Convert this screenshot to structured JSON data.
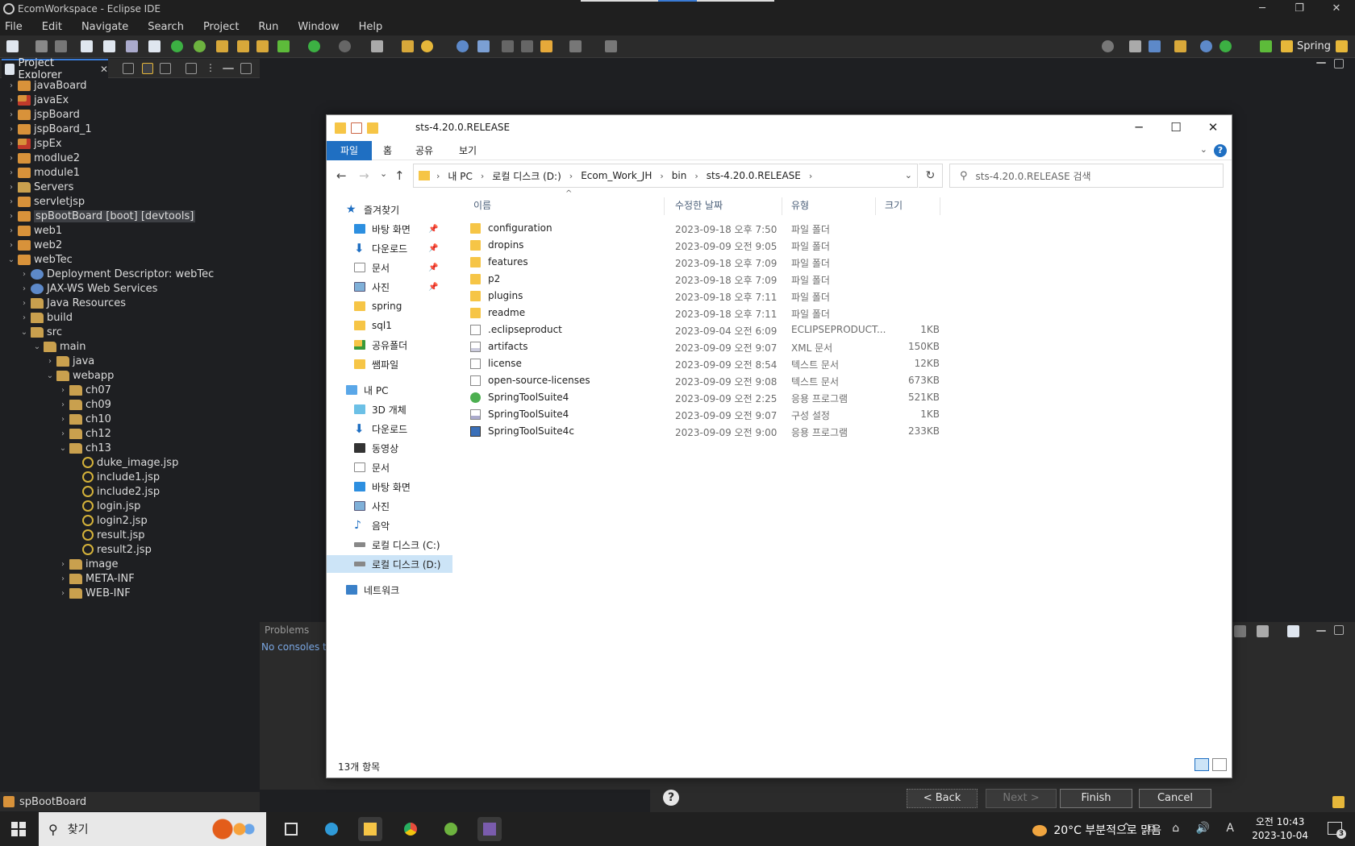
{
  "window": {
    "title": "EcomWorkspace - Eclipse IDE",
    "minimize": "─",
    "restore": "❐",
    "close": "✕"
  },
  "menu": [
    "File",
    "Edit",
    "Navigate",
    "Search",
    "Project",
    "Run",
    "Window",
    "Help"
  ],
  "toolbar": {
    "perspective_label": "Spring"
  },
  "project_explorer": {
    "tab_label": "Project Explorer",
    "tab_close": "✕",
    "items": [
      {
        "label": "javaBoard",
        "depth": 0,
        "expanded": false,
        "icon": "project-icon"
      },
      {
        "label": "javaEx",
        "depth": 0,
        "expanded": false,
        "icon": "project-error-icon"
      },
      {
        "label": "jspBoard",
        "depth": 0,
        "expanded": false,
        "icon": "project-icon"
      },
      {
        "label": "jspBoard_1",
        "depth": 0,
        "expanded": false,
        "icon": "project-icon"
      },
      {
        "label": "jspEx",
        "depth": 0,
        "expanded": false,
        "icon": "project-error-icon"
      },
      {
        "label": "modlue2",
        "depth": 0,
        "expanded": false,
        "icon": "project-icon"
      },
      {
        "label": "module1",
        "depth": 0,
        "expanded": false,
        "icon": "project-icon"
      },
      {
        "label": "Servers",
        "depth": 0,
        "expanded": false,
        "icon": "folder-icon"
      },
      {
        "label": "servletjsp",
        "depth": 0,
        "expanded": false,
        "icon": "project-icon"
      },
      {
        "label": "spBootBoard [boot] [devtools]",
        "depth": 0,
        "expanded": false,
        "icon": "project-icon",
        "selected": true
      },
      {
        "label": "web1",
        "depth": 0,
        "expanded": false,
        "icon": "project-icon"
      },
      {
        "label": "web2",
        "depth": 0,
        "expanded": false,
        "icon": "project-icon"
      },
      {
        "label": "webTec",
        "depth": 0,
        "expanded": true,
        "icon": "project-icon"
      },
      {
        "label": "Deployment Descriptor: webTec",
        "depth": 1,
        "expanded": false,
        "icon": "deployment-icon"
      },
      {
        "label": "JAX-WS Web Services",
        "depth": 1,
        "expanded": false,
        "icon": "deployment-icon"
      },
      {
        "label": "Java Resources",
        "depth": 1,
        "expanded": false,
        "icon": "folder-icon"
      },
      {
        "label": "build",
        "depth": 1,
        "expanded": false,
        "icon": "folder-icon"
      },
      {
        "label": "src",
        "depth": 1,
        "expanded": true,
        "icon": "folder-icon"
      },
      {
        "label": "main",
        "depth": 2,
        "expanded": true,
        "icon": "folder-icon"
      },
      {
        "label": "java",
        "depth": 3,
        "expanded": false,
        "icon": "folder-icon"
      },
      {
        "label": "webapp",
        "depth": 3,
        "expanded": true,
        "icon": "folder-icon"
      },
      {
        "label": "ch07",
        "depth": 4,
        "expanded": false,
        "icon": "folder-icon"
      },
      {
        "label": "ch09",
        "depth": 4,
        "expanded": false,
        "icon": "folder-icon"
      },
      {
        "label": "ch10",
        "depth": 4,
        "expanded": false,
        "icon": "folder-icon"
      },
      {
        "label": "ch12",
        "depth": 4,
        "expanded": false,
        "icon": "folder-icon"
      },
      {
        "label": "ch13",
        "depth": 4,
        "expanded": true,
        "icon": "folder-icon"
      },
      {
        "label": "duke_image.jsp",
        "depth": 5,
        "leaf": true,
        "icon": "jsp-file-icon"
      },
      {
        "label": "include1.jsp",
        "depth": 5,
        "leaf": true,
        "icon": "jsp-file-icon"
      },
      {
        "label": "include2.jsp",
        "depth": 5,
        "leaf": true,
        "icon": "jsp-file-icon"
      },
      {
        "label": "login.jsp",
        "depth": 5,
        "leaf": true,
        "icon": "jsp-file-icon"
      },
      {
        "label": "login2.jsp",
        "depth": 5,
        "leaf": true,
        "icon": "jsp-file-icon"
      },
      {
        "label": "result.jsp",
        "depth": 5,
        "leaf": true,
        "icon": "jsp-file-icon"
      },
      {
        "label": "result2.jsp",
        "depth": 5,
        "leaf": true,
        "icon": "jsp-file-icon"
      },
      {
        "label": "image",
        "depth": 4,
        "expanded": false,
        "icon": "folder-icon"
      },
      {
        "label": "META-INF",
        "depth": 4,
        "expanded": false,
        "icon": "folder-icon"
      },
      {
        "label": "WEB-INF",
        "depth": 4,
        "expanded": false,
        "icon": "folder-icon"
      }
    ],
    "bottom_label": "spBootBoard"
  },
  "console": {
    "problems_tab": "Problems",
    "message": "No consoles to"
  },
  "wizard_buttons": {
    "help": "?",
    "back": "< Back",
    "next": "Next >",
    "finish": "Finish",
    "cancel": "Cancel"
  },
  "file_explorer": {
    "title": "sts-4.20.0.RELEASE",
    "ribbon_tabs": {
      "file": "파일",
      "home": "홈",
      "share": "공유",
      "view": "보기"
    },
    "ribbon_help": "?",
    "nav": {
      "back": "←",
      "forward": "→",
      "history": "⌄",
      "up": "↑",
      "refresh": "↻",
      "dropdown": "⌄"
    },
    "breadcrumb": [
      "내 PC",
      "로컬 디스크 (D:)",
      "Ecom_Work_JH",
      "bin",
      "sts-4.20.0.RELEASE"
    ],
    "search_placeholder": "sts-4.20.0.RELEASE 검색",
    "nav_pane": [
      {
        "label": "즐겨찾기",
        "icon": "star-icon",
        "indent": 0
      },
      {
        "label": "바탕 화면",
        "icon": "desktop-icon",
        "indent": 1,
        "pinned": true
      },
      {
        "label": "다운로드",
        "icon": "download-icon",
        "indent": 1,
        "pinned": true
      },
      {
        "label": "문서",
        "icon": "document-icon",
        "indent": 1,
        "pinned": true
      },
      {
        "label": "사진",
        "icon": "picture-icon",
        "indent": 1,
        "pinned": true
      },
      {
        "label": "spring",
        "icon": "folder-icon",
        "indent": 1
      },
      {
        "label": "sql1",
        "icon": "folder-icon",
        "indent": 1
      },
      {
        "label": "공유폴더",
        "icon": "shared-folder-icon",
        "indent": 1
      },
      {
        "label": "쌤파일",
        "icon": "folder-icon",
        "indent": 1
      },
      {
        "label": "내 PC",
        "icon": "pc-icon",
        "indent": 0
      },
      {
        "label": "3D 개체",
        "icon": "cube-icon",
        "indent": 1
      },
      {
        "label": "다운로드",
        "icon": "download-icon",
        "indent": 1
      },
      {
        "label": "동영상",
        "icon": "video-icon",
        "indent": 1
      },
      {
        "label": "문서",
        "icon": "document-icon",
        "indent": 1
      },
      {
        "label": "바탕 화면",
        "icon": "desktop-icon",
        "indent": 1
      },
      {
        "label": "사진",
        "icon": "picture-icon",
        "indent": 1
      },
      {
        "label": "음악",
        "icon": "music-icon",
        "indent": 1
      },
      {
        "label": "로컬 디스크 (C:)",
        "icon": "drive-icon",
        "indent": 1
      },
      {
        "label": "로컬 디스크 (D:)",
        "icon": "drive-icon",
        "indent": 1,
        "selected": true
      },
      {
        "label": "네트워크",
        "icon": "network-icon",
        "indent": 0
      }
    ],
    "columns": {
      "name": "이름",
      "modified": "수정한 날짜",
      "type": "유형",
      "size": "크기"
    },
    "files": [
      {
        "name": "configuration",
        "modified": "2023-09-18 오후 7:50",
        "type": "파일 폴더",
        "size": "",
        "icon": "folder"
      },
      {
        "name": "dropins",
        "modified": "2023-09-09 오전 9:05",
        "type": "파일 폴더",
        "size": "",
        "icon": "folder"
      },
      {
        "name": "features",
        "modified": "2023-09-18 오후 7:09",
        "type": "파일 폴더",
        "size": "",
        "icon": "folder"
      },
      {
        "name": "p2",
        "modified": "2023-09-18 오후 7:09",
        "type": "파일 폴더",
        "size": "",
        "icon": "folder"
      },
      {
        "name": "plugins",
        "modified": "2023-09-18 오후 7:11",
        "type": "파일 폴더",
        "size": "",
        "icon": "folder"
      },
      {
        "name": "readme",
        "modified": "2023-09-18 오후 7:11",
        "type": "파일 폴더",
        "size": "",
        "icon": "folder"
      },
      {
        "name": ".eclipseproduct",
        "modified": "2023-09-04 오전 6:09",
        "type": "ECLIPSEPRODUCT...",
        "size": "1KB",
        "icon": "file"
      },
      {
        "name": "artifacts",
        "modified": "2023-09-09 오전 9:07",
        "type": "XML 문서",
        "size": "150KB",
        "icon": "xml"
      },
      {
        "name": "license",
        "modified": "2023-09-09 오전 8:54",
        "type": "텍스트 문서",
        "size": "12KB",
        "icon": "file"
      },
      {
        "name": "open-source-licenses",
        "modified": "2023-09-09 오전 9:08",
        "type": "텍스트 문서",
        "size": "673KB",
        "icon": "file"
      },
      {
        "name": "SpringToolSuite4",
        "modified": "2023-09-09 오전 2:25",
        "type": "응용 프로그램",
        "size": "521KB",
        "icon": "spring"
      },
      {
        "name": "SpringToolSuite4",
        "modified": "2023-09-09 오전 9:07",
        "type": "구성 설정",
        "size": "1KB",
        "icon": "ini"
      },
      {
        "name": "SpringToolSuite4c",
        "modified": "2023-09-09 오전 9:00",
        "type": "응용 프로그램",
        "size": "233KB",
        "icon": "exe"
      }
    ],
    "status": "13개 항목"
  },
  "taskbar": {
    "search_placeholder": "찾기",
    "weather": "20°C  부분적으로 맑음",
    "tray_icons": "^ ⧉ ⌂ 🔊 A",
    "time": "오전 10:43",
    "date": "2023-10-04",
    "notification_count": "3"
  }
}
